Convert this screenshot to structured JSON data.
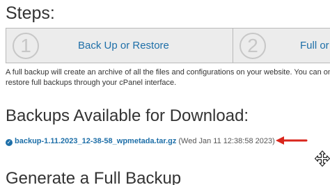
{
  "steps": {
    "title": "Steps:",
    "items": [
      {
        "number": "1",
        "label": "Back Up or Restore"
      },
      {
        "number": "2",
        "label": "Full or"
      }
    ]
  },
  "description": {
    "line1": "A full backup will create an archive of all the files and configurations on your website. You can on",
    "line2": "restore full backups through your cPanel interface."
  },
  "backups": {
    "title": "Backups Available for Download:",
    "items": [
      {
        "check_icon": "✓",
        "filename": "backup-1.11.2023_12-38-58_wpmetada.tar.gz",
        "date": "(Wed Jan 11 12:38:58 2023)"
      }
    ]
  },
  "generate": {
    "title": "Generate a Full Backup"
  },
  "colors": {
    "link": "#1e6fa8",
    "arrow": "#d9261c",
    "step_bg": "#ececec"
  },
  "icons": {
    "arrow": "left-arrow-annotation",
    "cursor": "move-cursor-icon"
  }
}
